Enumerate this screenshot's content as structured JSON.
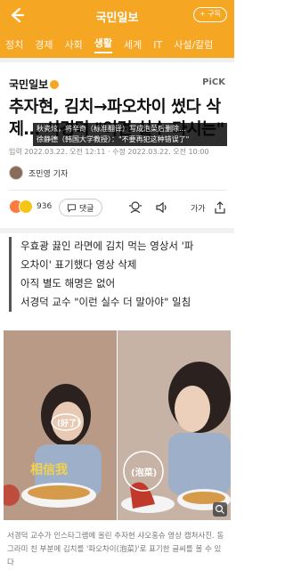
{
  "header": {
    "brand": "국민일보",
    "subscribe_label": "+ 구독"
  },
  "categories": [
    "정치",
    "경제",
    "사회",
    "생활",
    "세계",
    "IT",
    "사설/칼럼"
  ],
  "active_category": "생활",
  "article": {
    "publisher": "국민일보",
    "pick_badge": "PiCK",
    "headline": "추자현, 김치→파오차이 썼다 삭제… 서경덕 \"이런 실수 다시는\"",
    "overlay_caption_1": "秋瓷炫，将辛奇（标准翻译）写成泡菜后删除…",
    "overlay_caption_2": "徐静德（韩国大学教授）：\"不要再犯这种错误了\"",
    "dateline": "입력 2022.03.22. 오전 12:11 · 수정 2022.03.22. 오전 10:00",
    "reporter": "조민영 기자",
    "reaction_count": "936",
    "comment_label": "댓글",
    "font_size_label": "가가",
    "summary": [
      "우효광 끓인 라면에 김치 먹는 영상서 '파",
      "오차이' 표기했다 영상 삭제",
      "아직 별도 해명은 없어",
      "서경덕 교수 \"이런 실수 더 말아야\" 일침"
    ],
    "photo_text_left": "相信我",
    "photo_text_bubble_left": "(好了)",
    "photo_text_bubble_right": "(泡菜)",
    "photo_caption": "서경덕 교수가 인스타그램에 올린 추자현 샤오홍슈 영상 캡처사진. 동그라미 친 부분에 김치를 '파오차이(泡菜)'로 표기한 글씨를 볼 수 있다"
  },
  "colors": {
    "brand": "#f5a623",
    "text": "#222222",
    "muted": "#888888"
  },
  "icons": [
    "back-arrow-icon",
    "comment-icon",
    "audio-icon",
    "speaker-icon",
    "share-icon",
    "zoom-icon",
    "reaction-icon"
  ]
}
